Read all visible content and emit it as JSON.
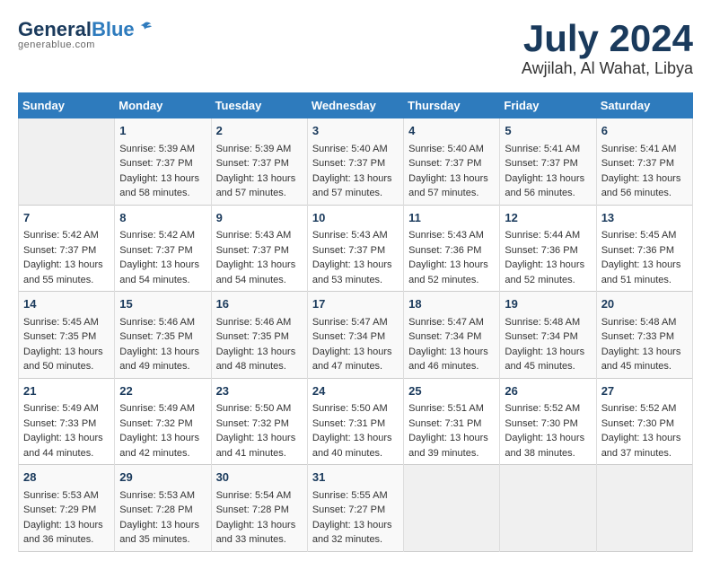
{
  "logo": {
    "general": "General",
    "blue": "Blue"
  },
  "title": {
    "month": "July 2024",
    "location": "Awjilah, Al Wahat, Libya"
  },
  "calendar": {
    "headers": [
      "Sunday",
      "Monday",
      "Tuesday",
      "Wednesday",
      "Thursday",
      "Friday",
      "Saturday"
    ],
    "weeks": [
      [
        {
          "day": "",
          "content": ""
        },
        {
          "day": "1",
          "content": "Sunrise: 5:39 AM\nSunset: 7:37 PM\nDaylight: 13 hours\nand 58 minutes."
        },
        {
          "day": "2",
          "content": "Sunrise: 5:39 AM\nSunset: 7:37 PM\nDaylight: 13 hours\nand 57 minutes."
        },
        {
          "day": "3",
          "content": "Sunrise: 5:40 AM\nSunset: 7:37 PM\nDaylight: 13 hours\nand 57 minutes."
        },
        {
          "day": "4",
          "content": "Sunrise: 5:40 AM\nSunset: 7:37 PM\nDaylight: 13 hours\nand 57 minutes."
        },
        {
          "day": "5",
          "content": "Sunrise: 5:41 AM\nSunset: 7:37 PM\nDaylight: 13 hours\nand 56 minutes."
        },
        {
          "day": "6",
          "content": "Sunrise: 5:41 AM\nSunset: 7:37 PM\nDaylight: 13 hours\nand 56 minutes."
        }
      ],
      [
        {
          "day": "7",
          "content": "Sunrise: 5:42 AM\nSunset: 7:37 PM\nDaylight: 13 hours\nand 55 minutes."
        },
        {
          "day": "8",
          "content": "Sunrise: 5:42 AM\nSunset: 7:37 PM\nDaylight: 13 hours\nand 54 minutes."
        },
        {
          "day": "9",
          "content": "Sunrise: 5:43 AM\nSunset: 7:37 PM\nDaylight: 13 hours\nand 54 minutes."
        },
        {
          "day": "10",
          "content": "Sunrise: 5:43 AM\nSunset: 7:37 PM\nDaylight: 13 hours\nand 53 minutes."
        },
        {
          "day": "11",
          "content": "Sunrise: 5:43 AM\nSunset: 7:36 PM\nDaylight: 13 hours\nand 52 minutes."
        },
        {
          "day": "12",
          "content": "Sunrise: 5:44 AM\nSunset: 7:36 PM\nDaylight: 13 hours\nand 52 minutes."
        },
        {
          "day": "13",
          "content": "Sunrise: 5:45 AM\nSunset: 7:36 PM\nDaylight: 13 hours\nand 51 minutes."
        }
      ],
      [
        {
          "day": "14",
          "content": "Sunrise: 5:45 AM\nSunset: 7:35 PM\nDaylight: 13 hours\nand 50 minutes."
        },
        {
          "day": "15",
          "content": "Sunrise: 5:46 AM\nSunset: 7:35 PM\nDaylight: 13 hours\nand 49 minutes."
        },
        {
          "day": "16",
          "content": "Sunrise: 5:46 AM\nSunset: 7:35 PM\nDaylight: 13 hours\nand 48 minutes."
        },
        {
          "day": "17",
          "content": "Sunrise: 5:47 AM\nSunset: 7:34 PM\nDaylight: 13 hours\nand 47 minutes."
        },
        {
          "day": "18",
          "content": "Sunrise: 5:47 AM\nSunset: 7:34 PM\nDaylight: 13 hours\nand 46 minutes."
        },
        {
          "day": "19",
          "content": "Sunrise: 5:48 AM\nSunset: 7:34 PM\nDaylight: 13 hours\nand 45 minutes."
        },
        {
          "day": "20",
          "content": "Sunrise: 5:48 AM\nSunset: 7:33 PM\nDaylight: 13 hours\nand 45 minutes."
        }
      ],
      [
        {
          "day": "21",
          "content": "Sunrise: 5:49 AM\nSunset: 7:33 PM\nDaylight: 13 hours\nand 44 minutes."
        },
        {
          "day": "22",
          "content": "Sunrise: 5:49 AM\nSunset: 7:32 PM\nDaylight: 13 hours\nand 42 minutes."
        },
        {
          "day": "23",
          "content": "Sunrise: 5:50 AM\nSunset: 7:32 PM\nDaylight: 13 hours\nand 41 minutes."
        },
        {
          "day": "24",
          "content": "Sunrise: 5:50 AM\nSunset: 7:31 PM\nDaylight: 13 hours\nand 40 minutes."
        },
        {
          "day": "25",
          "content": "Sunrise: 5:51 AM\nSunset: 7:31 PM\nDaylight: 13 hours\nand 39 minutes."
        },
        {
          "day": "26",
          "content": "Sunrise: 5:52 AM\nSunset: 7:30 PM\nDaylight: 13 hours\nand 38 minutes."
        },
        {
          "day": "27",
          "content": "Sunrise: 5:52 AM\nSunset: 7:30 PM\nDaylight: 13 hours\nand 37 minutes."
        }
      ],
      [
        {
          "day": "28",
          "content": "Sunrise: 5:53 AM\nSunset: 7:29 PM\nDaylight: 13 hours\nand 36 minutes."
        },
        {
          "day": "29",
          "content": "Sunrise: 5:53 AM\nSunset: 7:28 PM\nDaylight: 13 hours\nand 35 minutes."
        },
        {
          "day": "30",
          "content": "Sunrise: 5:54 AM\nSunset: 7:28 PM\nDaylight: 13 hours\nand 33 minutes."
        },
        {
          "day": "31",
          "content": "Sunrise: 5:55 AM\nSunset: 7:27 PM\nDaylight: 13 hours\nand 32 minutes."
        },
        {
          "day": "",
          "content": ""
        },
        {
          "day": "",
          "content": ""
        },
        {
          "day": "",
          "content": ""
        }
      ]
    ]
  }
}
